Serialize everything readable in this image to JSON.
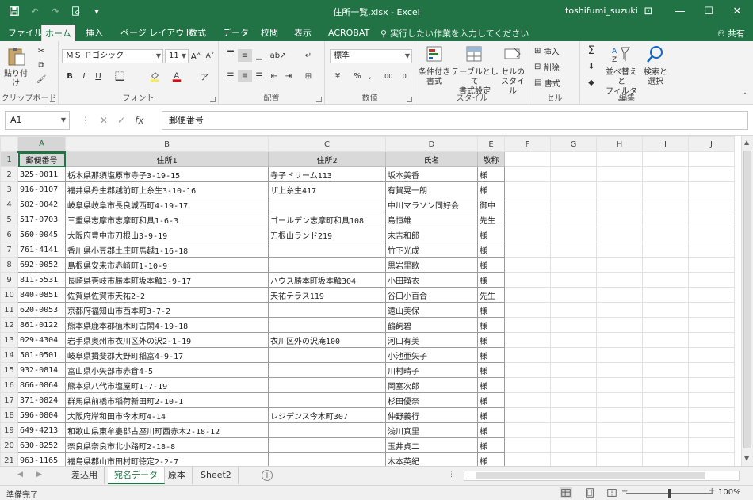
{
  "window": {
    "title": "住所一覧.xlsx - Excel",
    "user": "toshifumi_suzuki",
    "accent": "#217346"
  },
  "tabs": [
    "ファイル",
    "ホーム",
    "挿入",
    "ページ レイアウト",
    "数式",
    "データ",
    "校閲",
    "表示",
    "ACROBAT"
  ],
  "active_tab": "ホーム",
  "tell_me": "実行したい作業を入力してください",
  "share": "共有",
  "ribbon": {
    "clipboard": {
      "label": "クリップボード",
      "paste": "貼り付け"
    },
    "font": {
      "label": "フォント",
      "name": "ＭＳ Ｐゴシック",
      "size": "11",
      "bold": "B",
      "italic": "I",
      "underline": "U"
    },
    "alignment": {
      "label": "配置"
    },
    "number": {
      "label": "数値",
      "format": "標準"
    },
    "styles": {
      "label": "スタイル",
      "cond": "条件付き\n書式",
      "table": "テーブルとして\n書式設定",
      "cell": "セルの\nスタイル"
    },
    "cells": {
      "label": "セル",
      "insert": "挿入",
      "delete": "削除",
      "format": "書式"
    },
    "editing": {
      "label": "編集",
      "sort": "並べ替えと\nフィルター",
      "find": "検索と\n選択"
    }
  },
  "formula_bar": {
    "name_box": "A1",
    "content": "郵便番号"
  },
  "columns": [
    "A",
    "B",
    "C",
    "D",
    "E",
    "F",
    "G",
    "H",
    "I",
    "J"
  ],
  "header_row": [
    "郵便番号",
    "住所1",
    "住所2",
    "氏名",
    "敬称"
  ],
  "rows": [
    [
      "325-0011",
      "栃木県那須塩原市寺子3-19-15",
      "寺子ドリーム113",
      "坂本美香",
      "様"
    ],
    [
      "916-0107",
      "福井県丹生郡越前町上糸生3-10-16",
      "ザ上糸生417",
      "有賀晃一朗",
      "様"
    ],
    [
      "502-0042",
      "岐阜県岐阜市長良城西町4-19-17",
      "",
      "中川マラソン同好会",
      "御中"
    ],
    [
      "517-0703",
      "三重県志摩市志摩町和具1-6-3",
      "ゴールデン志摩町和具108",
      "島恒雄",
      "先生"
    ],
    [
      "560-0045",
      "大阪府豊中市刀根山3-9-19",
      "刀根山ランド219",
      "末吉和郎",
      "様"
    ],
    [
      "761-4141",
      "香川県小豆郡土庄町馬越1-16-18",
      "",
      "竹下光成",
      "様"
    ],
    [
      "692-0052",
      "島根県安来市赤崎町1-10-9",
      "",
      "黒岩里歌",
      "様"
    ],
    [
      "811-5531",
      "長崎県壱岐市勝本町坂本触3-9-17",
      "ハウス勝本町坂本触304",
      "小田瑠衣",
      "様"
    ],
    [
      "840-0851",
      "佐賀県佐賀市天祐2-2",
      "天祐テラス119",
      "谷口小百合",
      "先生"
    ],
    [
      "620-0053",
      "京都府福知山市西本町3-7-2",
      "",
      "遠山美保",
      "様"
    ],
    [
      "861-0122",
      "熊本県鹿本郡植木町古閑4-19-18",
      "",
      "鶴飼碧",
      "様"
    ],
    [
      "029-4304",
      "岩手県奥州市衣川区外の沢2-1-19",
      "衣川区外の沢庵100",
      "河口有美",
      "様"
    ],
    [
      "501-0501",
      "岐阜県揖斐郡大野町稲富4-9-17",
      "",
      "小池亜矢子",
      "様"
    ],
    [
      "932-0814",
      "富山県小矢部市赤倉4-5",
      "",
      "川村晴子",
      "様"
    ],
    [
      "866-0864",
      "熊本県八代市塩屋町1-7-19",
      "",
      "岡室次郎",
      "様"
    ],
    [
      "371-0824",
      "群馬県前橋市稲荷新田町2-10-1",
      "",
      "杉田優奈",
      "様"
    ],
    [
      "596-0804",
      "大阪府岸和田市今木町4-14",
      "レジデンス今木町307",
      "仲野義行",
      "様"
    ],
    [
      "649-4213",
      "和歌山県東牟婁郡古座川町西赤木2-18-12",
      "",
      "浅川真里",
      "様"
    ],
    [
      "630-8252",
      "奈良県奈良市北小路町2-18-8",
      "",
      "玉井貞二",
      "様"
    ],
    [
      "963-1165",
      "福島県郡山市田村町徳定2-2-7",
      "",
      "木本英紀",
      "様"
    ]
  ],
  "sheets": [
    "差込用",
    "宛名データ",
    "原本",
    "Sheet2"
  ],
  "active_sheet": "宛名データ",
  "status": {
    "ready": "準備完了",
    "zoom": "100%"
  }
}
